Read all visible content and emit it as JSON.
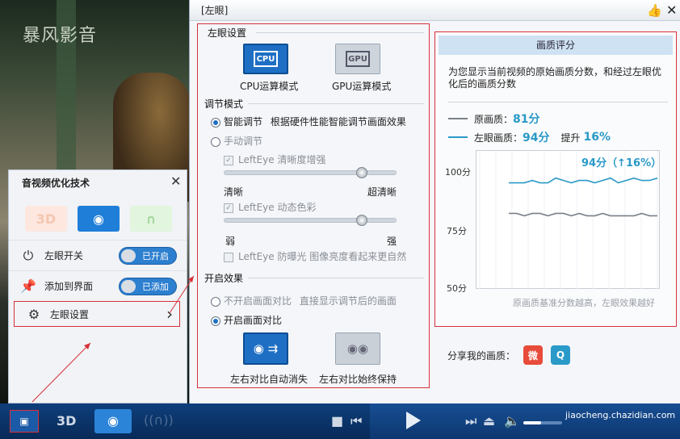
{
  "video": {
    "watermark": "暴风影音"
  },
  "popup": {
    "title": "音视频优化技术",
    "tabs": {
      "t3d": "3D"
    },
    "rows": [
      {
        "label": "左眼开关",
        "toggle": "已开启"
      },
      {
        "label": "添加到界面",
        "toggle": "已添加"
      },
      {
        "label": "左眼设置"
      }
    ]
  },
  "dialog": {
    "title": "[左眼]",
    "left_eye_settings": "左眼设置",
    "cpu_label": "CPU运算模式",
    "gpu_label": "GPU运算模式",
    "cpu_chip": "CPU",
    "gpu_chip": "GPU",
    "adjust_mode": "调节模式",
    "smart_adjust": "智能调节",
    "smart_desc": "根据硬件性能智能调节画面效果",
    "manual_adjust": "手动调节",
    "clarity_enhance": "LeftEye  清晰度增强",
    "clear": "清晰",
    "super_clear": "超清晰",
    "dynamic_color": "LeftEye  动态色彩",
    "weak": "弱",
    "strong": "强",
    "anti_exposure": "LeftEye  防曝光 图像亮度看起来更自然",
    "on_effect": "开启效果",
    "no_compare": "不开启画面对比",
    "no_compare_desc": "直接显示调节后的画面",
    "enable_compare": "开启画面对比",
    "auto_vanish": "左右对比自动消失",
    "keep": "左右对比始终保持"
  },
  "score": {
    "header": "画质评分",
    "desc": "为您显示当前视频的原始画质分数，和经过左眼优化后的画质分数",
    "orig_label": "原画质：",
    "orig_value": "81分",
    "left_label": "左眼画质：",
    "left_value": "94分",
    "boost_label": "提升",
    "boost_value": "16%",
    "annotation": "94分（↑16%）",
    "note": "原画质基准分数越高，左眼效果越好",
    "share": "分享我的画质："
  },
  "chart_data": {
    "type": "line",
    "ylim": [
      50,
      100
    ],
    "yticks": [
      "100分",
      "75分",
      "50分"
    ],
    "series": [
      {
        "name": "原画质",
        "values": [
          81,
          81,
          80,
          81,
          81,
          80,
          81,
          81,
          80,
          81,
          80,
          80,
          81,
          80,
          80,
          80,
          80,
          81,
          80,
          80
        ]
      },
      {
        "name": "左眼画质",
        "values": [
          94,
          94,
          94,
          95,
          94,
          94,
          96,
          95,
          94,
          95,
          95,
          94,
          95,
          96,
          94,
          95,
          96,
          95,
          95,
          96
        ]
      }
    ],
    "colors": {
      "原画质": "#7a8088",
      "左眼画质": "#2a9ac8"
    }
  },
  "bottom": {
    "t3d": "3D",
    "site": "jiaocheng.chazidian.com"
  }
}
